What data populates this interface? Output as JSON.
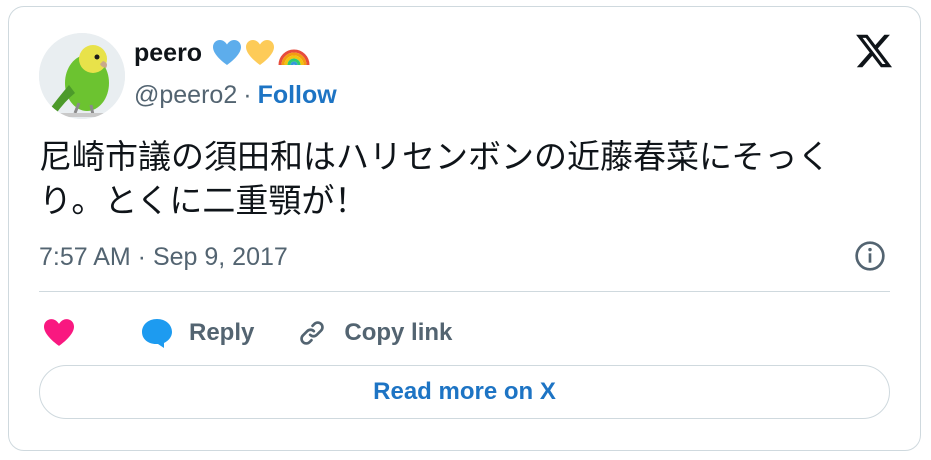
{
  "user": {
    "display_name": "peero",
    "handle": "@peero2",
    "separator": "·",
    "follow_label": "Follow",
    "emoji_icons": [
      "blue-heart-icon",
      "yellow-heart-icon",
      "rainbow-icon"
    ]
  },
  "tweet": {
    "text": "尼崎市議の須田和はハリセンボンの近藤春菜にそっくり。とくに二重顎が！",
    "timestamp": "7:57 AM · Sep 9, 2017"
  },
  "actions": {
    "reply_label": "Reply",
    "copy_link_label": "Copy link"
  },
  "read_more_label": "Read more on X",
  "colors": {
    "accent": "#1d74c4",
    "heart": "#f91880",
    "reply_bubble": "#1d9bf0",
    "muted": "#536471",
    "border": "#cfd9de"
  }
}
